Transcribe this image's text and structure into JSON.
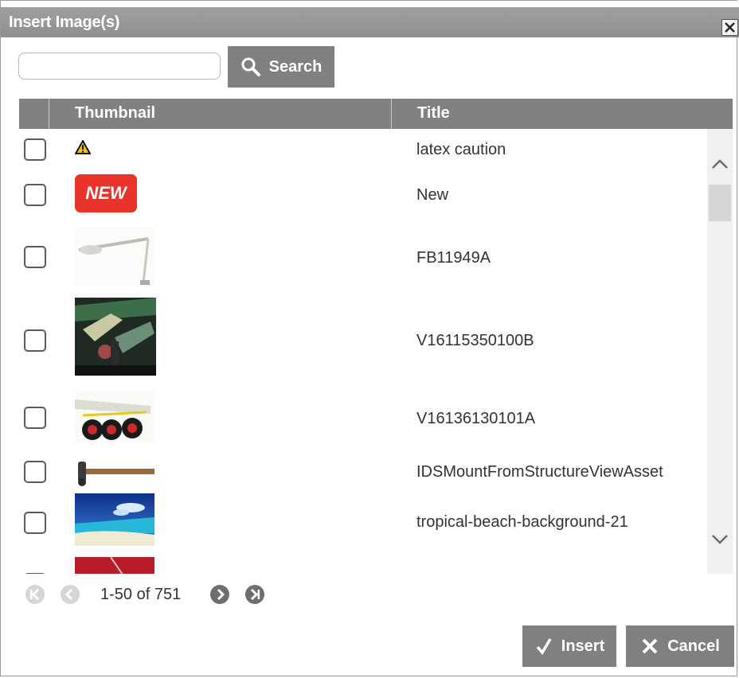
{
  "dialog": {
    "title": "Insert Image(s)",
    "close_icon": "close-icon"
  },
  "search": {
    "value": "",
    "placeholder": "",
    "button_label": "Search",
    "icon": "magnifier-icon"
  },
  "grid": {
    "columns": [
      "Thumbnail",
      "Title"
    ],
    "rows": [
      {
        "title": "latex caution",
        "thumbnail": "warning-triangle",
        "checked": false
      },
      {
        "title": "New",
        "thumbnail": "new-badge",
        "badge_text": "NEW",
        "checked": false
      },
      {
        "title": "FB11949A",
        "thumbnail": "lamp-arm-photo",
        "checked": false
      },
      {
        "title": "V16115350100B",
        "thumbnail": "engine-bay-photo",
        "checked": false
      },
      {
        "title": "V16136130101A",
        "thumbnail": "wheels-photo",
        "checked": false
      },
      {
        "title": "IDSMountFromStructureViewAsset",
        "thumbnail": "hammer-photo",
        "checked": false
      },
      {
        "title": "tropical-beach-background-21",
        "thumbnail": "beach-photo",
        "checked": false
      },
      {
        "title": "",
        "thumbnail": "red-photo",
        "checked": false
      }
    ]
  },
  "pager": {
    "range_text": "1-50 of 751",
    "first_icon": "first-page-icon",
    "prev_icon": "previous-page-icon",
    "next_icon": "next-page-icon",
    "last_icon": "last-page-icon"
  },
  "actions": {
    "insert_label": "Insert",
    "cancel_label": "Cancel"
  },
  "colors": {
    "titlebar": "#999999",
    "header": "#808080",
    "button": "#808080",
    "new_badge": "#e8342a"
  }
}
